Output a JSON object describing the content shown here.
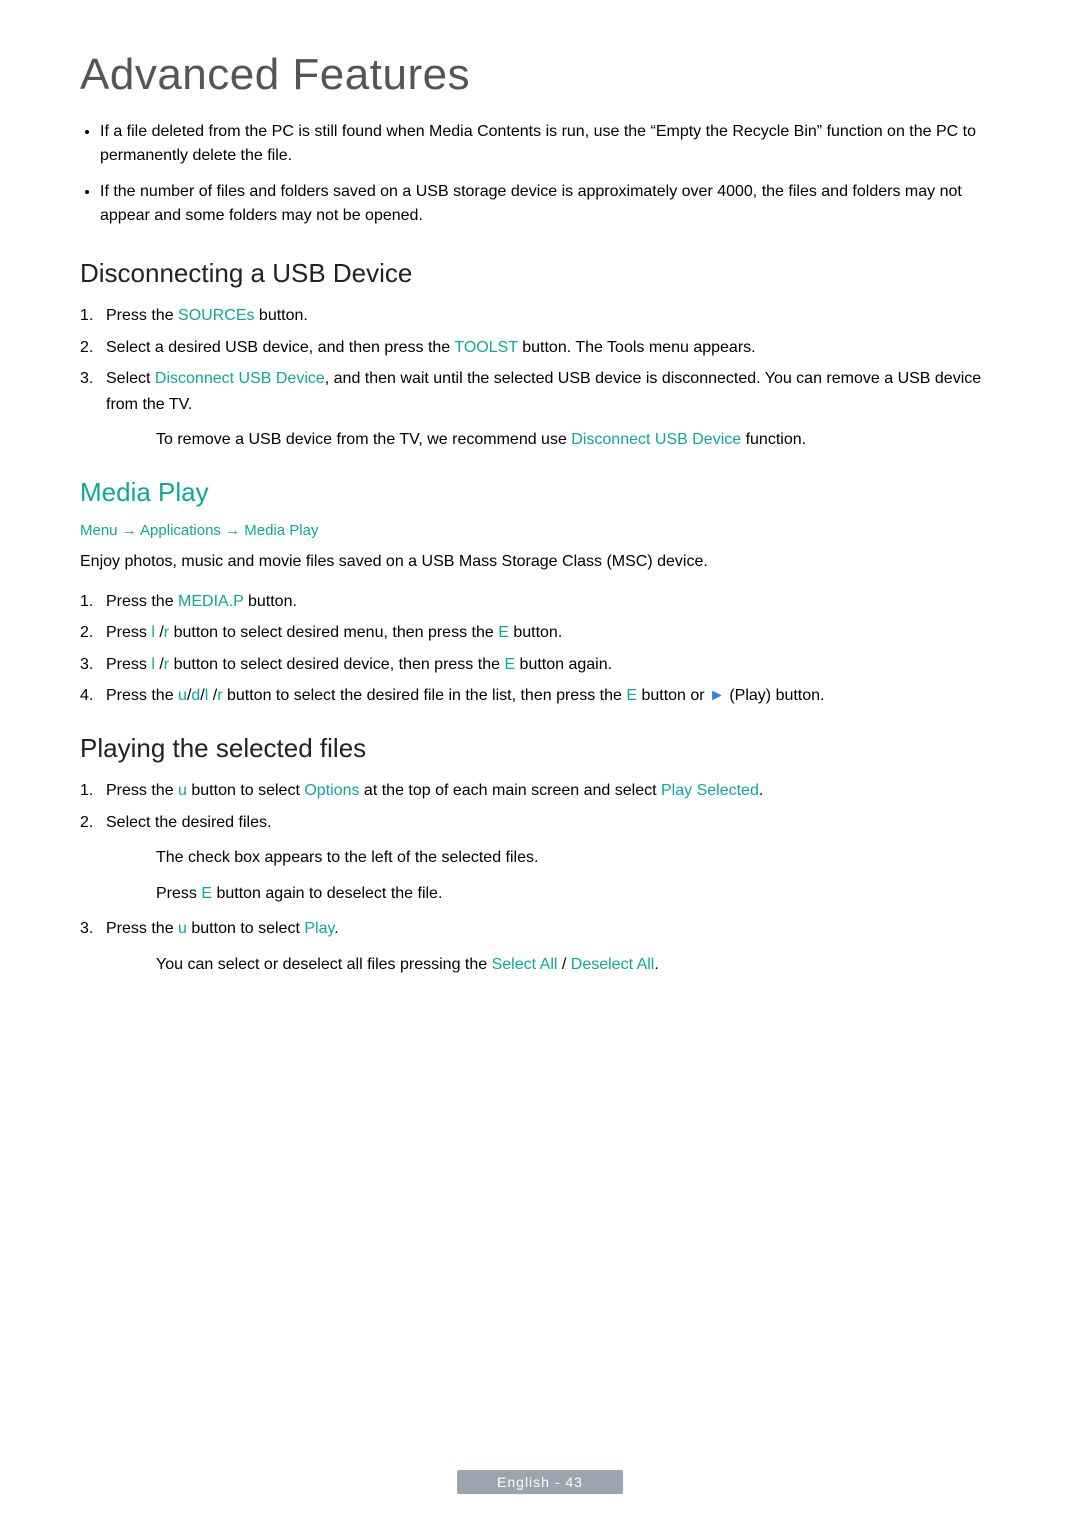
{
  "page_title": "Advanced Features",
  "intro_bullets": [
    "If a ﬁle deleted from the PC is still found when Media Contents is run, use the “Empty the Recycle Bin” function on the PC to permanently delete the ﬁle.",
    "If the number of ﬁles and folders saved on a USB storage device is approximately over 4000, the ﬁles and folders may not appear and some folders may not be opened."
  ],
  "disconnect": {
    "title": "Disconnecting a USB Device",
    "step1_pre": "Press the ",
    "step1_hl": "SOURCEs",
    "step1_post": " button.",
    "step2_pre": "Select a desired USB device, and then press the ",
    "step2_hl": "TOOLST",
    "step2_post": " button. The Tools menu appears.",
    "step3_pre": "Select ",
    "step3_hl": "Disconnect USB Device",
    "step3_post": ", and then wait until the selected USB device is disconnected. You can remove a USB device from the TV.",
    "note_pre": "To remove a USB device from the TV, we recommend use ",
    "note_hl": "Disconnect USB Device",
    "note_post": " function."
  },
  "media": {
    "title": "Media Play",
    "crumb_menu": "Menu",
    "crumb_arrow1": " → ",
    "crumb_apps": "Applications",
    "crumb_arrow2": " → ",
    "crumb_play": "Media Play",
    "intro": "Enjoy photos, music and movie ﬁles saved on a USB Mass Storage Class (MSC) device.",
    "s1_pre": "Press the ",
    "s1_hl": "MEDIA.P",
    "s1_post": " button.",
    "s2_pre": "Press ",
    "s2_hl_l": "l",
    "s2_mid1": " /",
    "s2_hl_r": "r",
    "s2_mid2": " button to select desired menu, then press the ",
    "s2_hl_e": "E",
    "s2_post": " button.",
    "s3_pre": "Press ",
    "s3_hl_l": "l",
    "s3_mid1": " /",
    "s3_hl_r": "r",
    "s3_mid2": " button to select desired device, then press the ",
    "s3_hl_e": "E",
    "s3_post": " button again.",
    "s4_pre": "Press the ",
    "s4_u": "u",
    "s4_slash1": "/",
    "s4_d": "d",
    "s4_slash2": "/",
    "s4_l": "l",
    "s4_gap": "",
    "s4_slash3": " /",
    "s4_r": "r",
    "s4_mid": " button to select the desired ﬁle in the list, then press the ",
    "s4_e": "E",
    "s4_mid2": " button or ",
    "s4_play": "►",
    "s4_post": " (Play) button."
  },
  "playing": {
    "title": "Playing the selected ﬁles",
    "s1_pre": "Press the ",
    "s1_u": "u",
    "s1_mid": " button to select ",
    "s1_opts": "Options",
    "s1_mid2": " at the top of each main screen and select ",
    "s1_ps": "Play Selected",
    "s1_post": ".",
    "s2": "Select the desired ﬁles.",
    "n1": "The check box appears to the left of the selected files.",
    "n2_pre": "Press ",
    "n2_e": "E",
    "n2_post": " button again to deselect the file.",
    "s3_pre": "Press the ",
    "s3_u": "u",
    "s3_mid": " button to select ",
    "s3_play": "Play",
    "s3_post": ".",
    "n3_pre": "You can select or deselect all files pressing the ",
    "n3_sa": "Select All",
    "n3_slash": " / ",
    "n3_da": "Deselect All",
    "n3_post": "."
  },
  "footer": "English - 43"
}
